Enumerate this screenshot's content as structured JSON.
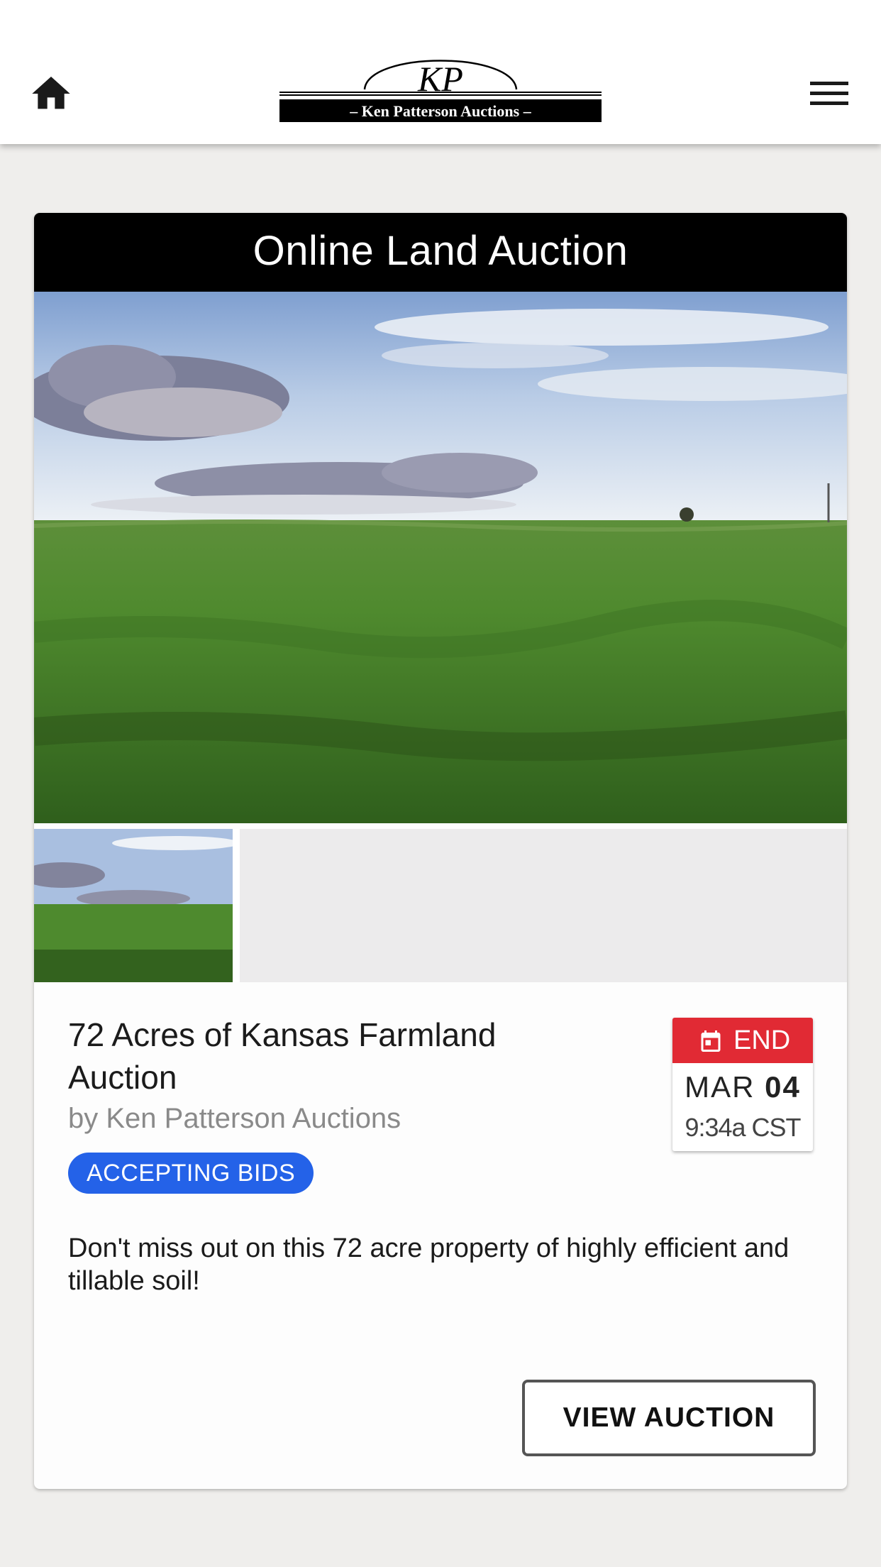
{
  "header": {
    "home_icon": "home-icon",
    "menu_icon": "hamburger-menu-icon",
    "logo": {
      "monogram": "KP",
      "text": "– Ken Patterson Auctions –"
    }
  },
  "card": {
    "banner": "Online Land Auction",
    "hero_image": "green wheat field under cloudy sky",
    "title": "72 Acres of Kansas Farmland Auction",
    "byline": "by Ken Patterson Auctions",
    "status": "ACCEPTING BIDS",
    "end": {
      "label": "END",
      "icon": "calendar-icon",
      "month": "MAR",
      "day": "04",
      "time": "9:34a CST"
    },
    "description": "Don't miss out on this 72 acre property of highly efficient and tillable soil!",
    "view_button": "VIEW AUCTION"
  },
  "colors": {
    "accent_blue": "#2462e8",
    "end_red": "#e12a34",
    "banner_black": "#000000"
  }
}
